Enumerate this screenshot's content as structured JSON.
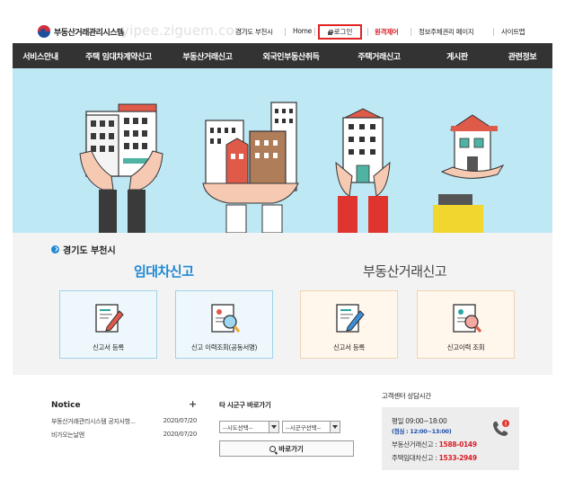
{
  "header": {
    "logo_text": "부동산거래관리시스템",
    "watermark": "yipee.ziguem.com",
    "region_link": "경기도 부천시",
    "home_link": "Home",
    "login_label": "로그인",
    "remote_label": "원격제어",
    "privacy_link": "정보주체권리 페이지",
    "sitemap_link": "사이트맵"
  },
  "nav": {
    "items": [
      {
        "label": "서비스안내"
      },
      {
        "label": "주택 임대차계약신고"
      },
      {
        "label": "부동산거래신고"
      },
      {
        "label": "외국인부동산취득"
      },
      {
        "label": "주택거래신고"
      },
      {
        "label": "게시판"
      },
      {
        "label": "관련정보"
      }
    ]
  },
  "section": {
    "region": "경기도 부천시",
    "lease_title": "임대차신고",
    "sale_title": "부동산거래신고",
    "cards": [
      {
        "label": "신고서 등록",
        "icon": "edit-document-icon"
      },
      {
        "label": "신고 이력조회(공동서명)",
        "icon": "search-document-icon"
      },
      {
        "label": "신고서 등록",
        "icon": "edit-document-icon"
      },
      {
        "label": "신고이력 조회",
        "icon": "search-document-icon"
      }
    ]
  },
  "notice": {
    "title": "Notice",
    "plus": "+",
    "items": [
      {
        "title": "부동산거래관리시스템 공지사항...",
        "date": "2020/07/20"
      },
      {
        "title": "비가오는날엔",
        "date": "2020/07/20"
      }
    ]
  },
  "shortcut": {
    "title": "타 시군구 바로가기",
    "sido_selected": "--시도선택--",
    "sigungu_selected": "--시군구선택--",
    "go_label": "바로가기"
  },
  "support": {
    "title": "고객센터 상담시간",
    "hours": "평일 09:00~18:00",
    "lunch": "(점심 : 12:00~13:00)",
    "sale_label": "부동산거래신고 : ",
    "sale_phone": "1588-0149",
    "lease_label": "주택임대차신고 : ",
    "lease_phone": "1533-2949",
    "badge": "!"
  },
  "colors": {
    "nav_bg": "#333333",
    "hero_bg": "#bfe8f5",
    "accent_blue": "#1e88d4",
    "alert_red": "#d81f26"
  }
}
